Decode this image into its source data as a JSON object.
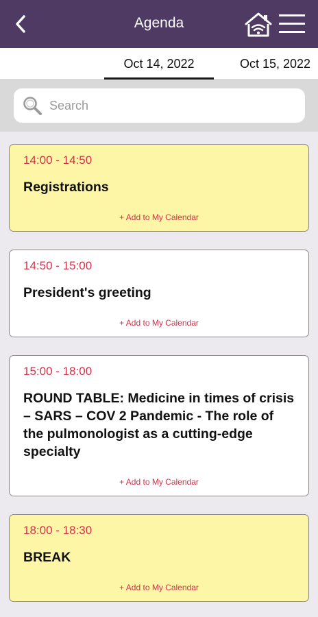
{
  "header": {
    "title": "Agenda",
    "back_icon": "chevron-left-icon",
    "home_icon": "home-wifi-icon",
    "menu_icon": "hamburger-menu-icon"
  },
  "tabs": [
    {
      "label": "Oct 14, 2022",
      "active": true
    },
    {
      "label": "Oct 15, 2022",
      "active": false
    }
  ],
  "search": {
    "placeholder": "Search",
    "value": ""
  },
  "colors": {
    "appbar": "#4f3a63",
    "accent": "#d6304a",
    "highlight_card": "#fdf6a6"
  },
  "agenda": [
    {
      "time": "14:00 - 14:50",
      "title": "Registrations",
      "action": "+ Add to My Calendar",
      "highlighted": true
    },
    {
      "time": "14:50 - 15:00",
      "title": "President's greeting",
      "action": "+ Add to My Calendar",
      "highlighted": false
    },
    {
      "time": "15:00 - 18:00",
      "title": "ROUND TABLE: Medicine in times of crisis – SARS – COV 2 Pandemic - The role of the pulmonologist as a cutting-edge specialty",
      "action": "+ Add to My Calendar",
      "highlighted": false
    },
    {
      "time": "18:00 - 18:30",
      "title": "BREAK",
      "action": "+ Add to My Calendar",
      "highlighted": true
    }
  ]
}
